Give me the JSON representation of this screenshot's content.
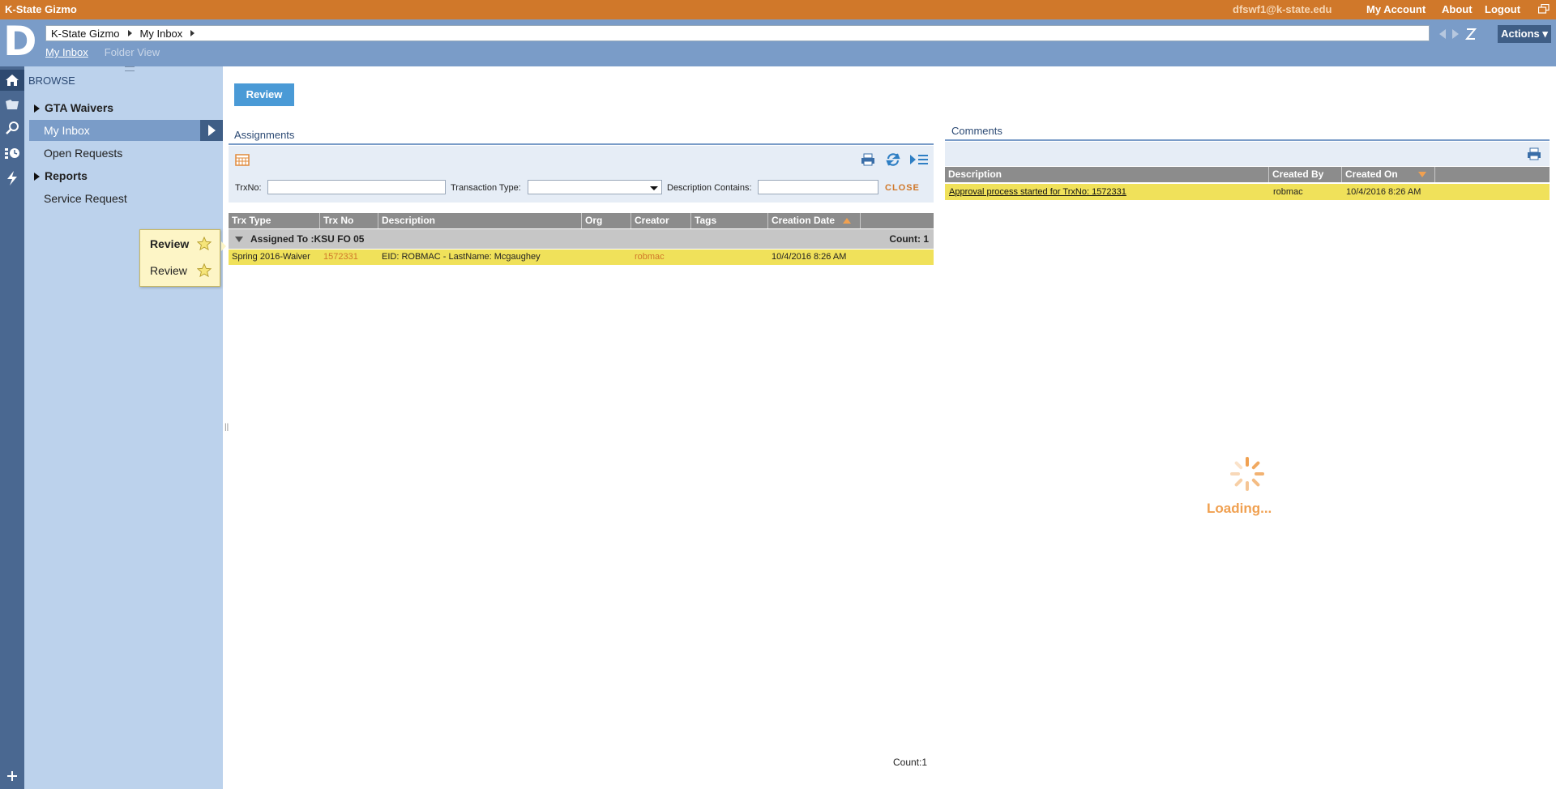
{
  "topbar": {
    "brand": "K-State Gizmo",
    "user": "dfswf1@k-state.edu",
    "links": [
      "My Account",
      "About",
      "Logout"
    ]
  },
  "header": {
    "logo": "D",
    "breadcrumb": [
      "K-State Gizmo",
      "My Inbox"
    ],
    "actions_label": "Actions ▾",
    "tabs": [
      {
        "label": "My Inbox",
        "active": true
      },
      {
        "label": "Folder View",
        "active": false
      }
    ]
  },
  "browse": {
    "title": "BROWSE",
    "items": [
      {
        "label": "GTA Waivers",
        "expandable": true
      },
      {
        "label": "My Inbox",
        "selected": true
      },
      {
        "label": "Open Requests"
      },
      {
        "label": "Reports",
        "expandable": true
      },
      {
        "label": "Service Request"
      }
    ]
  },
  "popup": {
    "items": [
      "Review",
      "Review"
    ]
  },
  "main": {
    "review_button": "Review",
    "assignments": {
      "title": "Assignments",
      "filters": {
        "trxno_label": "TrxNo:",
        "trxno_value": "",
        "type_label": "Transaction Type:",
        "type_value": "",
        "desc_label": "Description Contains:",
        "desc_value": "",
        "close_label": "CLOSE"
      },
      "columns": [
        "Trx Type",
        "Trx No",
        "Description",
        "Org",
        "Creator",
        "Tags",
        "Creation Date"
      ],
      "group": {
        "label": "Assigned To :KSU FO 05",
        "count": "Count: 1"
      },
      "rows": [
        {
          "trx_type": "Spring 2016-Waiver",
          "trx_no": "1572331",
          "description": "EID: ROBMAC - LastName: Mcgaughey",
          "org": "",
          "creator": "robmac",
          "tags": "",
          "creation_date": "10/4/2016 8:26 AM"
        }
      ],
      "footer_count": "Count:1"
    },
    "comments": {
      "title": "Comments",
      "columns": [
        "Description",
        "Created By",
        "Created On"
      ],
      "rows": [
        {
          "description": "Approval process started for TrxNo: 1572331",
          "created_by": "robmac",
          "created_on": "10/4/2016 8:26 AM"
        }
      ],
      "loading": "Loading..."
    }
  },
  "colors": {
    "topbar": "#d0782a",
    "header": "#7a9cc8",
    "rail": "#4a6891",
    "browse": "#bcd2ec",
    "highlight_row": "#f0e15a",
    "accent_orange": "#d0782a",
    "button_blue": "#4a9ad6"
  }
}
